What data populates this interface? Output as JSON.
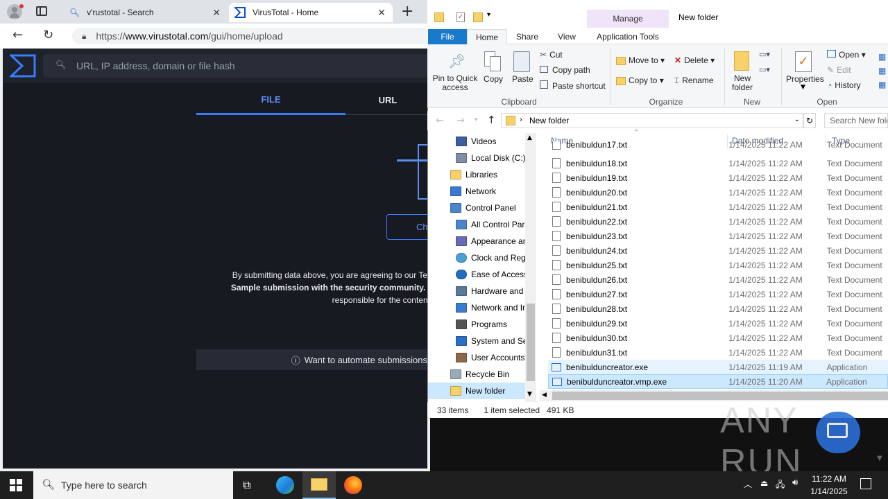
{
  "browser": {
    "tabs": [
      {
        "label": "v'rustotal - Search"
      },
      {
        "label": "VirusTotal - Home"
      }
    ],
    "url_prefix": "https://",
    "url_host": "www.virustotal.com",
    "url_path": "/gui/home/upload"
  },
  "virustotal": {
    "search_placeholder": "URL, IP address, domain or file hash",
    "tab_file": "FILE",
    "tab_url": "URL",
    "choose_button": "Ch",
    "terms_line1": "By submitting data above, you are agreeing to our Ter",
    "terms_line2": "Sample submission with the security community. I",
    "terms_line3": "responsible for the content",
    "automate": "Want to automate submissions"
  },
  "explorer": {
    "title": "New folder",
    "manage_label": "Manage",
    "ribbon_tabs": [
      "File",
      "Home",
      "Share",
      "View",
      "Application Tools"
    ],
    "clipboard": {
      "pin": "Pin to Quick access",
      "pin_line1": "Pin to Quick",
      "pin_line2": "access",
      "copy": "Copy",
      "paste": "Paste",
      "cut": "Cut",
      "copy_path": "Copy path",
      "paste_shortcut": "Paste shortcut",
      "group": "Clipboard"
    },
    "organize": {
      "move_to": "Move to",
      "copy_to": "Copy to",
      "delete": "Delete",
      "rename": "Rename",
      "group": "Organize"
    },
    "new": {
      "new_folder_line1": "New",
      "new_folder_line2": "folder",
      "group": "New"
    },
    "open": {
      "properties": "Properties",
      "open": "Open",
      "edit": "Edit",
      "history": "History",
      "group": "Open"
    },
    "path": "New folder",
    "search_placeholder": "Search New fold",
    "nav_items": [
      {
        "label": "Videos",
        "icon": "video-icon"
      },
      {
        "label": "Local Disk (C:)",
        "icon": "disk-icon"
      },
      {
        "label": "Libraries",
        "icon": "libraries-icon"
      },
      {
        "label": "Network",
        "icon": "network-icon"
      },
      {
        "label": "Control Panel",
        "icon": "control-panel-icon"
      },
      {
        "label": "All Control Par",
        "icon": "control-panel-icon"
      },
      {
        "label": "Appearance an",
        "icon": "appearance-icon"
      },
      {
        "label": "Clock and Regi",
        "icon": "clock-icon"
      },
      {
        "label": "Ease of Access",
        "icon": "ease-of-access-icon"
      },
      {
        "label": "Hardware and",
        "icon": "hardware-icon"
      },
      {
        "label": "Network and Ir",
        "icon": "network-icon"
      },
      {
        "label": "Programs",
        "icon": "programs-icon"
      },
      {
        "label": "System and Se",
        "icon": "shield-icon"
      },
      {
        "label": "User Accounts",
        "icon": "users-icon"
      },
      {
        "label": "Recycle Bin",
        "icon": "recycle-bin-icon"
      },
      {
        "label": "New folder",
        "icon": "folder-icon"
      }
    ],
    "columns": {
      "name": "Name",
      "date": "Date modified",
      "type": "Type"
    },
    "files": [
      {
        "name": "benibuldun17.txt",
        "date": "1/14/2025 11:22 AM",
        "type": "Text Document",
        "kind": "txt"
      },
      {
        "name": "benibuldun18.txt",
        "date": "1/14/2025 11:22 AM",
        "type": "Text Document",
        "kind": "txt"
      },
      {
        "name": "benibuldun19.txt",
        "date": "1/14/2025 11:22 AM",
        "type": "Text Document",
        "kind": "txt"
      },
      {
        "name": "benibuldun20.txt",
        "date": "1/14/2025 11:22 AM",
        "type": "Text Document",
        "kind": "txt"
      },
      {
        "name": "benibuldun21.txt",
        "date": "1/14/2025 11:22 AM",
        "type": "Text Document",
        "kind": "txt"
      },
      {
        "name": "benibuldun22.txt",
        "date": "1/14/2025 11:22 AM",
        "type": "Text Document",
        "kind": "txt"
      },
      {
        "name": "benibuldun23.txt",
        "date": "1/14/2025 11:22 AM",
        "type": "Text Document",
        "kind": "txt"
      },
      {
        "name": "benibuldun24.txt",
        "date": "1/14/2025 11:22 AM",
        "type": "Text Document",
        "kind": "txt"
      },
      {
        "name": "benibuldun25.txt",
        "date": "1/14/2025 11:22 AM",
        "type": "Text Document",
        "kind": "txt"
      },
      {
        "name": "benibuldun26.txt",
        "date": "1/14/2025 11:22 AM",
        "type": "Text Document",
        "kind": "txt"
      },
      {
        "name": "benibuldun27.txt",
        "date": "1/14/2025 11:22 AM",
        "type": "Text Document",
        "kind": "txt"
      },
      {
        "name": "benibuldun28.txt",
        "date": "1/14/2025 11:22 AM",
        "type": "Text Document",
        "kind": "txt"
      },
      {
        "name": "benibuldun29.txt",
        "date": "1/14/2025 11:22 AM",
        "type": "Text Document",
        "kind": "txt"
      },
      {
        "name": "benibuldun30.txt",
        "date": "1/14/2025 11:22 AM",
        "type": "Text Document",
        "kind": "txt"
      },
      {
        "name": "benibuldun31.txt",
        "date": "1/14/2025 11:22 AM",
        "type": "Text Document",
        "kind": "txt"
      },
      {
        "name": "benibulduncreator.exe",
        "date": "1/14/2025 11:19 AM",
        "type": "Application",
        "kind": "exe"
      },
      {
        "name": "benibulduncreator.vmp.exe",
        "date": "1/14/2025 11:20 AM",
        "type": "Application",
        "kind": "exe"
      }
    ],
    "status": {
      "items": "33 items",
      "selected": "1 item selected",
      "size": "491 KB"
    }
  },
  "taskbar": {
    "search_placeholder": "Type here to search",
    "time": "11:22 AM",
    "date": "1/14/2025"
  },
  "watermark": "ANY RUN",
  "colors": {
    "vt_bg": "#171a21",
    "vt_accent": "#0b4dda",
    "vt_tab_active": "#3a7bff",
    "explorer_selection": "#cce8ff",
    "file_tab": "#1979ca"
  }
}
